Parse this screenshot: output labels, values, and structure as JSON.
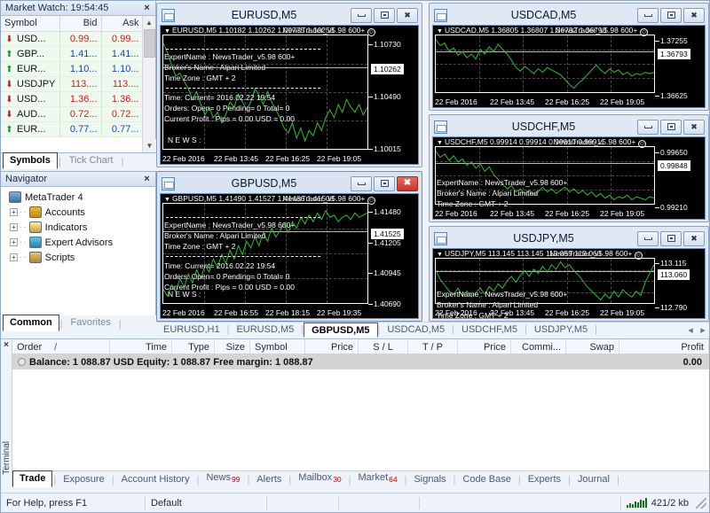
{
  "market_watch": {
    "title": "Market Watch: 19:54:45",
    "close_label": "×",
    "columns": [
      "Symbol",
      "Bid",
      "Ask"
    ],
    "rows": [
      {
        "dir": "down",
        "symbol": "USD...",
        "bid": "0.99...",
        "ask": "0.99...",
        "color": "#d01818"
      },
      {
        "dir": "up",
        "symbol": "GBP...",
        "bid": "1.41...",
        "ask": "1.41...",
        "color": "#1a3fd0"
      },
      {
        "dir": "up",
        "symbol": "EUR...",
        "bid": "1.10...",
        "ask": "1.10...",
        "color": "#1a3fd0"
      },
      {
        "dir": "down",
        "symbol": "USDJPY",
        "bid": "113....",
        "ask": "113....",
        "color": "#d01818"
      },
      {
        "dir": "down",
        "symbol": "USD...",
        "bid": "1.36...",
        "ask": "1.36...",
        "color": "#d01818"
      },
      {
        "dir": "down",
        "symbol": "AUD...",
        "bid": "0.72...",
        "ask": "0.72...",
        "color": "#d01818"
      },
      {
        "dir": "up",
        "symbol": "EUR...",
        "bid": "0.77...",
        "ask": "0.77...",
        "color": "#1a3fd0"
      }
    ],
    "tabs": [
      {
        "label": "Symbols",
        "active": true
      },
      {
        "label": "Tick Chart",
        "active": false
      }
    ]
  },
  "navigator": {
    "title": "Navigator",
    "close_label": "×",
    "items": [
      {
        "label": "MetaTrader 4",
        "icon": "metatrader-icon",
        "expandable": false,
        "indent": 0
      },
      {
        "label": "Accounts",
        "icon": "accounts-icon",
        "expandable": true,
        "indent": 1
      },
      {
        "label": "Indicators",
        "icon": "indicators-icon",
        "expandable": true,
        "indent": 1
      },
      {
        "label": "Expert Advisors",
        "icon": "expert-advisors-icon",
        "expandable": true,
        "indent": 1
      },
      {
        "label": "Scripts",
        "icon": "scripts-icon",
        "expandable": true,
        "indent": 1
      }
    ],
    "tabs": [
      {
        "label": "Common",
        "active": true
      },
      {
        "label": "Favorites",
        "active": false
      }
    ]
  },
  "chart_windows": [
    {
      "id": "eurusd-m5",
      "title": "EURUSD,M5",
      "active": false,
      "buttons": {
        "minimize": "minimize-button",
        "restore": "restore-button",
        "close": "close-button"
      },
      "close_style": "normal",
      "header": {
        "symbol_period": "EURUSD,M5",
        "ohlc": "1.10182 1.10262 1.09775 1.10258",
        "ea_overlay": "NewsTrader_v5.98 600+",
        "smiley": ":)"
      },
      "info_lines": [
        "ExpertName : NewsTrader_v5.98 600+",
        "Broker's Name :  Alpari Limited",
        "Time Zone : GMT + 2"
      ],
      "status_lines": [
        "Time: Current= 2016.02.22 19:54",
        "Orders: Open= 0 Pending= 0 Total= 0",
        "Current Profit :  Pips = 0.00 USD = 0.00"
      ],
      "news_label": "N E W S :",
      "y_labels": [
        "1.10730",
        "1.10490",
        "1.10015"
      ],
      "y_current": "1.10262",
      "x_labels": [
        "22 Feb 2016",
        "22 Feb 13:45",
        "22 Feb 16:25",
        "22 Feb 19:05"
      ],
      "series": [
        95,
        88,
        78,
        70,
        72,
        66,
        60,
        52,
        58,
        48,
        40,
        46,
        38,
        42,
        34,
        40,
        50,
        46,
        56,
        50,
        44,
        50,
        60,
        55,
        48,
        58,
        50,
        44,
        38,
        30,
        26,
        34,
        22,
        30,
        20,
        28,
        24,
        34,
        28,
        38,
        44,
        38,
        48,
        42,
        52,
        46,
        42,
        48,
        40,
        46
      ]
    },
    {
      "id": "usdcad-m5",
      "title": "USDCAD,M5",
      "active": false,
      "buttons": {
        "minimize": "minimize-button",
        "restore": "restore-button",
        "close": "close-button"
      },
      "close_style": "normal",
      "header": {
        "symbol_period": "USDCAD,M5",
        "ohlc": "1.36805 1.36807 1.36792 1.36793",
        "ea_overlay": "NewsTrader_v5.98 600+",
        "smiley": ":)"
      },
      "info_lines": [],
      "status_lines": [],
      "news_label": "",
      "y_labels": [
        "1.37255",
        "1.36625"
      ],
      "y_current": "1.36793",
      "x_labels": [
        "22 Feb 2016",
        "22 Feb 13:45",
        "22 Feb 16:25",
        "22 Feb 19:05"
      ],
      "series": [
        96,
        86,
        90,
        76,
        82,
        70,
        76,
        66,
        72,
        64,
        80,
        72,
        84,
        76,
        88,
        80,
        72,
        62,
        50,
        44,
        52,
        46,
        40,
        48,
        42,
        50,
        46,
        42,
        38,
        30,
        22,
        16,
        24,
        30,
        38,
        46,
        54,
        46,
        40,
        48,
        42,
        46,
        38,
        42,
        36,
        40,
        38,
        42,
        40,
        42
      ]
    },
    {
      "id": "usdchf-m5",
      "title": "USDCHF,M5",
      "active": false,
      "buttons": {
        "minimize": "minimize-button",
        "restore": "restore-button",
        "close": "close-button"
      },
      "close_style": "normal",
      "header": {
        "symbol_period": "USDCHF,M5",
        "ohlc": "0.99914 0.99914 0.99910 0.99911",
        "ea_overlay": "NewsTrader_v5.98 600+",
        "smiley": ":)"
      },
      "info_lines": [
        "ExpertName : NewsTrader_v5.98 600+",
        "Broker's Name :  Alpari Limited",
        "Time Zone : GMT + 2"
      ],
      "status_lines": [],
      "news_label": "",
      "y_labels": [
        "0.99650",
        "0.99210"
      ],
      "y_current": "0.99848",
      "x_labels": [
        "22 Feb 2016",
        "22 Feb 13:45",
        "22 Feb 16:25",
        "22 Feb 19:05"
      ],
      "series": [
        70,
        62,
        66,
        58,
        64,
        56,
        60,
        52,
        56,
        48,
        54,
        44,
        50,
        40,
        34,
        28,
        22,
        26,
        18,
        22,
        16,
        20,
        14,
        18,
        24,
        18,
        22,
        16,
        20,
        24,
        18,
        22,
        16,
        20,
        14,
        18,
        12,
        16,
        10,
        14,
        8,
        12,
        10,
        14,
        8,
        12,
        10,
        8,
        12,
        10
      ]
    },
    {
      "id": "usdjpy-m5",
      "title": "USDJPY,M5",
      "active": false,
      "buttons": {
        "minimize": "minimize-button",
        "restore": "restore-button",
        "close": "close-button"
      },
      "close_style": "normal",
      "header": {
        "symbol_period": "USDJPY,M5",
        "ohlc": "113.145 113.145 113.059 113.060",
        "ea_overlay": "NewsTrader_v5.98 600+",
        "smiley": ":)"
      },
      "info_lines": [
        "ExpertName : NewsTrader_v5.98 600+",
        "Broker's Name :  Alpari Limited",
        "Time Zone : GMT + 2"
      ],
      "status_lines": [],
      "news_label": "",
      "y_labels": [
        "113.115",
        "112.790"
      ],
      "y_current": "113.060",
      "x_labels": [
        "22 Feb 2016",
        "22 Feb 13:45",
        "22 Feb 16:25",
        "22 Feb 19:05"
      ],
      "series": [
        62,
        50,
        42,
        34,
        30,
        38,
        28,
        34,
        26,
        32,
        38,
        30,
        40,
        34,
        44,
        38,
        48,
        54,
        46,
        56,
        62,
        54,
        64,
        58,
        68,
        60,
        70,
        64,
        74,
        66,
        70,
        62,
        56,
        48,
        40,
        34,
        28,
        22,
        30,
        24,
        34,
        26,
        36,
        30,
        26,
        34,
        28,
        46,
        58,
        70
      ]
    },
    {
      "id": "gbpusd-m5",
      "title": "GBPUSD,M5",
      "active": true,
      "buttons": {
        "minimize": "minimize-button",
        "restore": "restore-button",
        "close": "close-button"
      },
      "close_style": "red",
      "header": {
        "symbol_period": "GBPUSD,M5",
        "ohlc": "1.41490 1.41527 1.41486 1.41508",
        "ea_overlay": "NewsTrader_v5.98 600+",
        "smiley": ":)"
      },
      "info_lines": [
        "ExpertName : NewsTrader_v5.98 600+",
        "Broker's Name :  Alpari Limited",
        "Time Zone : GMT + 2"
      ],
      "status_lines": [
        "Time: Current= 2016.02.22 19:54",
        "Orders: Open= 0 Pending= 0 Total= 0",
        "Current Profit :  Pips = 0.00 USD = 0.00"
      ],
      "news_label": "N E W S :",
      "y_labels": [
        "1.41480",
        "1.41205",
        "1.40945",
        "1.40690"
      ],
      "y_current": "1.41525",
      "x_labels": [
        "22 Feb 2016",
        "22 Feb 16:55",
        "22 Feb 18:15",
        "22 Feb 19:35"
      ],
      "series": [
        18,
        12,
        22,
        16,
        28,
        20,
        32,
        24,
        36,
        28,
        40,
        34,
        46,
        38,
        50,
        42,
        54,
        46,
        58,
        50,
        62,
        56,
        66,
        58,
        70,
        62,
        74,
        66,
        72,
        78,
        70,
        80,
        74,
        84,
        78,
        86,
        80,
        88,
        82,
        90,
        84,
        86,
        80,
        84,
        86,
        82,
        88,
        84,
        86,
        88
      ]
    }
  ],
  "chart_tabs": {
    "tabs": [
      {
        "label": "EURUSD,H1",
        "active": false
      },
      {
        "label": "EURUSD,M5",
        "active": false
      },
      {
        "label": "GBPUSD,M5",
        "active": true
      },
      {
        "label": "USDCAD,M5",
        "active": false
      },
      {
        "label": "USDCHF,M5",
        "active": false
      },
      {
        "label": "USDJPY,M5",
        "active": false
      }
    ],
    "scroll_left": "◂",
    "scroll_right": "▸"
  },
  "terminal": {
    "vertical_label": "Terminal",
    "close_label": "×",
    "columns": [
      "Order",
      "Time",
      "Type",
      "Size",
      "Symbol",
      "Price",
      "S / L",
      "T / P",
      "Price",
      "Commi...",
      "Swap",
      "Profit"
    ],
    "sort_marker": "/",
    "balance_row": {
      "text": "Balance: 1 088.87 USD  Equity: 1 088.87  Free margin: 1 088.87",
      "profit": "0.00"
    },
    "tabs": [
      {
        "label": "Trade",
        "active": true,
        "badge": ""
      },
      {
        "label": "Exposure",
        "active": false,
        "badge": ""
      },
      {
        "label": "Account History",
        "active": false,
        "badge": ""
      },
      {
        "label": "News",
        "active": false,
        "badge": "99"
      },
      {
        "label": "Alerts",
        "active": false,
        "badge": ""
      },
      {
        "label": "Mailbox",
        "active": false,
        "badge": "30"
      },
      {
        "label": "Market",
        "active": false,
        "badge": "64"
      },
      {
        "label": "Signals",
        "active": false,
        "badge": ""
      },
      {
        "label": "Code Base",
        "active": false,
        "badge": ""
      },
      {
        "label": "Experts",
        "active": false,
        "badge": ""
      },
      {
        "label": "Journal",
        "active": false,
        "badge": ""
      }
    ]
  },
  "statusbar": {
    "help_text": "For Help, press F1",
    "profile": "Default",
    "traffic": "421/2 kb"
  },
  "colors": {
    "chart_bg": "#000000",
    "chart_line": "#2fbf2f",
    "price_up": "#1a3fd0",
    "price_down": "#d01818",
    "accent_close_red": "#c8352a",
    "panel_bg": "#eef3fa"
  }
}
